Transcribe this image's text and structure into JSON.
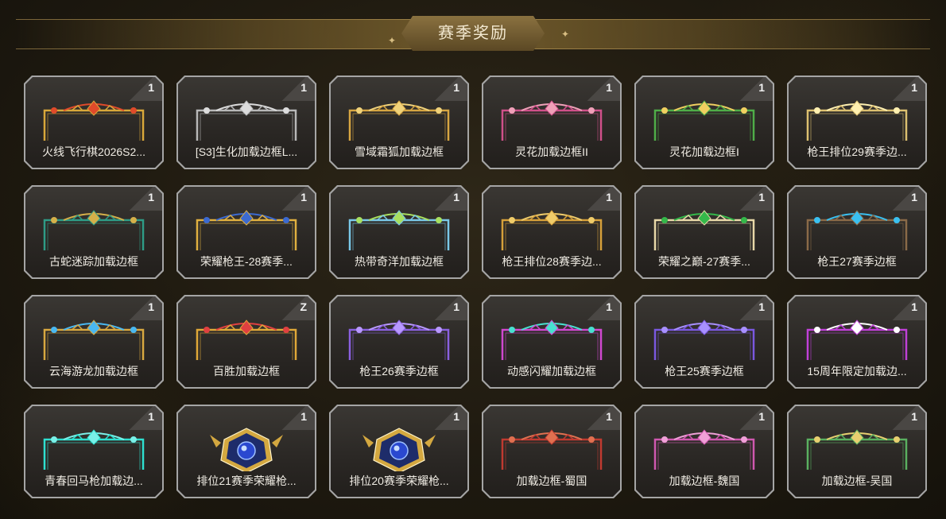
{
  "header": {
    "title": "赛季奖励"
  },
  "items": [
    {
      "label": "火线飞行棋2026S2...",
      "count": "1",
      "icon": "gold-wing-frame-icon",
      "color": "#d9a83a",
      "accent": "#e04a2a"
    },
    {
      "label": "[S3]生化加载边框L...",
      "count": "1",
      "icon": "silver-frame-icon",
      "color": "#b8b8b8",
      "accent": "#dcdcdc"
    },
    {
      "label": "雪域霜狐加载边框",
      "count": "1",
      "icon": "gold-fox-frame-icon",
      "color": "#d7a642",
      "accent": "#f0d27a"
    },
    {
      "label": "灵花加载边框II",
      "count": "1",
      "icon": "pink-flower-frame-icon",
      "color": "#d0508a",
      "accent": "#f0a0b8"
    },
    {
      "label": "灵花加载边框I",
      "count": "1",
      "icon": "green-flower-frame-icon",
      "color": "#4fae48",
      "accent": "#f0d060"
    },
    {
      "label": "枪王排位29赛季边...",
      "count": "1",
      "icon": "gold-filigree-frame-icon",
      "color": "#dcc070",
      "accent": "#fff0b0"
    },
    {
      "label": "古蛇迷踪加载边框",
      "count": "1",
      "icon": "serpent-frame-icon",
      "color": "#2e9c86",
      "accent": "#d4b04a"
    },
    {
      "label": "荣耀枪王-28赛季...",
      "count": "1",
      "icon": "gold-blue-crown-frame-icon",
      "color": "#e0b040",
      "accent": "#3c6ad0"
    },
    {
      "label": "热带奇洋加载边框",
      "count": "1",
      "icon": "tropical-wave-frame-icon",
      "color": "#7ac8e8",
      "accent": "#a8e060"
    },
    {
      "label": "枪王排位28赛季边...",
      "count": "1",
      "icon": "gold-frame-icon",
      "color": "#d6a03a",
      "accent": "#f0cc6a"
    },
    {
      "label": "荣耀之巅-27赛季...",
      "count": "1",
      "icon": "emerald-wing-frame-icon",
      "color": "#e8d8a8",
      "accent": "#34b84a"
    },
    {
      "label": "枪王27赛季边框",
      "count": "1",
      "icon": "constellation-frame-icon",
      "color": "#8a6a48",
      "accent": "#3ac0f0"
    },
    {
      "label": "云海游龙加载边框",
      "count": "1",
      "icon": "cloud-dragon-frame-icon",
      "color": "#d8a840",
      "accent": "#4ab8f0"
    },
    {
      "label": "百胜加载边框",
      "count": "Z",
      "icon": "gold-ruby-frame-icon",
      "color": "#e0a838",
      "accent": "#e04040"
    },
    {
      "label": "枪王26赛季边框",
      "count": "1",
      "icon": "purple-frame-icon",
      "color": "#8a60e0",
      "accent": "#b898ff"
    },
    {
      "label": "动感闪耀加载边框",
      "count": "1",
      "icon": "neon-star-frame-icon",
      "color": "#d048d0",
      "accent": "#48e0d0"
    },
    {
      "label": "枪王25赛季边框",
      "count": "1",
      "icon": "violet-frame-icon",
      "color": "#7a58e0",
      "accent": "#a890ff"
    },
    {
      "label": "15周年限定加载边...",
      "count": "1",
      "icon": "anniversary-frame-icon",
      "color": "#c040d8",
      "accent": "#ffffff"
    },
    {
      "label": "青春回马枪加载边...",
      "count": "1",
      "icon": "cyan-tech-frame-icon",
      "color": "#2ee0d0",
      "accent": "#7af0e8"
    },
    {
      "label": "排位21赛季荣耀枪...",
      "count": "1",
      "icon": "rank-emblem-icon",
      "color": "#d4a840",
      "accent": "#2a48d0"
    },
    {
      "label": "排位20赛季荣耀枪...",
      "count": "1",
      "icon": "rank-emblem-icon",
      "color": "#d4a840",
      "accent": "#2a48d0"
    },
    {
      "label": "加载边框-蜀国",
      "count": "1",
      "icon": "shu-kingdom-frame-icon",
      "color": "#c03a30",
      "accent": "#e07050"
    },
    {
      "label": "加载边框-魏国",
      "count": "1",
      "icon": "wei-kingdom-frame-icon",
      "color": "#d058b0",
      "accent": "#f0a0d8"
    },
    {
      "label": "加载边框-吴国",
      "count": "1",
      "icon": "wu-kingdom-frame-icon",
      "color": "#5ab060",
      "accent": "#e8d070"
    }
  ]
}
